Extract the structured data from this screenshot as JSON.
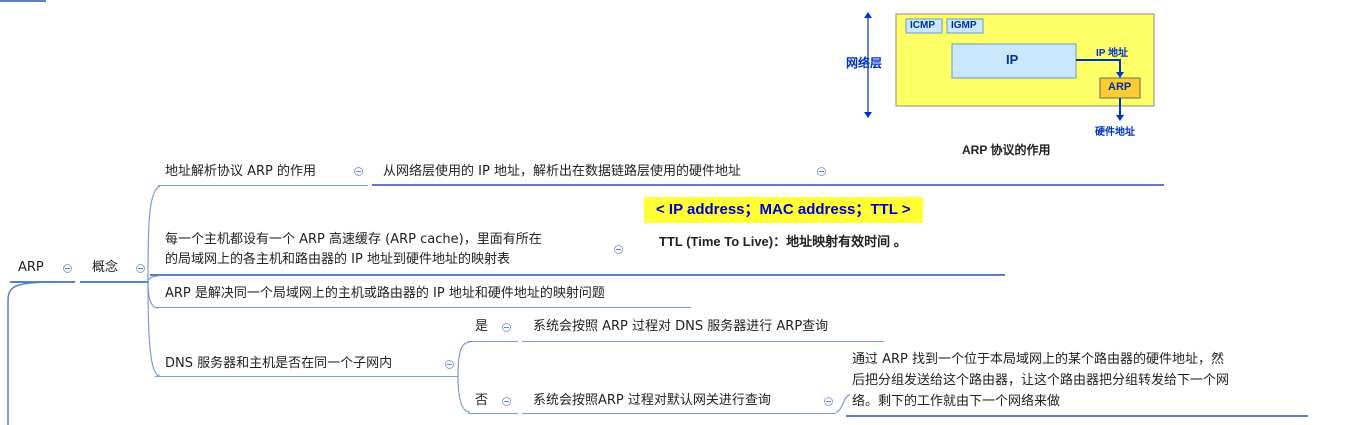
{
  "root": {
    "label": "ARP"
  },
  "concept": {
    "label": "概念"
  },
  "items": {
    "role": {
      "label": "地址解析协议 ARP 的作用",
      "detail": "从网络层使用的 IP 地址，解析出在数据链路层使用的硬件地址"
    },
    "cache": {
      "line1": "每一个主机都设有一个 ARP 高速缓存 (ARP cache)，里面有所在",
      "line2": "的局域网上的各主机和路由器的 IP 地址到硬件地址的映射表"
    },
    "problem": {
      "label": "ARP 是解决同一个局域网上的主机或路由器的 IP 地址和硬件地址的映射问题"
    },
    "dns": {
      "label": "DNS 服务器和主机是否在同一个子网内",
      "yes": {
        "label": "是",
        "detail": "系统会按照 ARP 过程对 DNS 服务器进行 ARP查询"
      },
      "no": {
        "label": "否",
        "detail": "系统会按照ARP 过程对默认网关进行查询",
        "note1": "通过 ARP 找到一个位于本局域网上的某个路由器的硬件地址，然",
        "note2": "后把分组发送给这个路由器，让这个路由器把分组转发给下一个网",
        "note3": "络。剩下的工作就由下一个网络来做"
      }
    }
  },
  "figure": {
    "network_layer": "网络层",
    "icmp": "ICMP",
    "igmp": "IGMP",
    "ip": "IP",
    "ip_addr": "IP 地址",
    "arp": "ARP",
    "hw_addr": "硬件地址",
    "caption": "ARP 协议的作用"
  },
  "cache_image": {
    "entry": "< IP address；MAC address；TTL >",
    "ttl_note": "TTL (Time To Live)：地址映射有效时间 。"
  },
  "colors": {
    "line": "#5b7fc7",
    "yellow": "#ffff66",
    "ipbox": "#cce8ff",
    "arpbox": "#ffcc33",
    "arrow": "#0033cc"
  }
}
